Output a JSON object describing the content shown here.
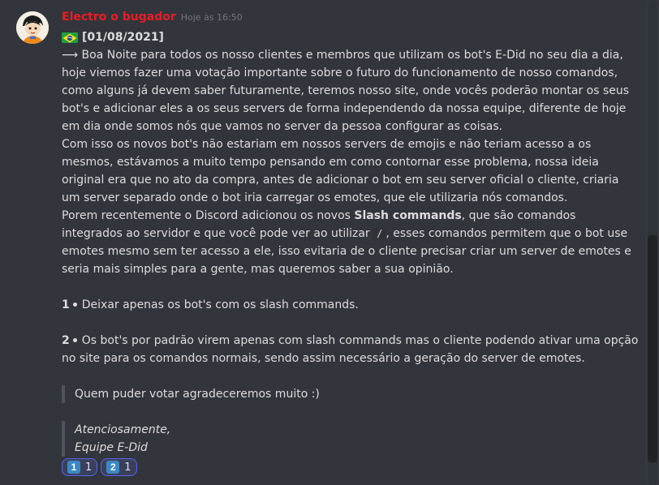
{
  "message": {
    "username": "Electro o bugador",
    "timestamp": "Hoje às 16:50",
    "date_line": "[01/08/2021]",
    "paragraph1": "⟶ Boa Noite para todos os nosso clientes e membros que utilizam os bot's E-Did no seu dia a dia, hoje viemos fazer uma votação importante sobre o futuro do funcionamento de nosso comandos, como alguns já devem saber futuramente, teremos nosso site, onde vocês poderão montar os seus bot's e adicionar eles a os seus servers de forma independendo da nossa equipe, diferente de hoje em dia onde somos nós que vamos no server da pessoa configurar as coisas.",
    "paragraph2": "Com isso os novos bot's não estariam em nossos servers de emojis e não teriam acesso a os mesmos, estávamos a muito tempo pensando em como contornar esse problema, nossa ideia original era que no ato da compra, antes de adicionar o bot em seu server oficial o cliente, criaria um server separado onde o bot iria carregar os emotes, que ele utilizaria nós comandos.",
    "paragraph3_pre": "Porem recentemente o Discord adicionou os novos ",
    "paragraph3_bold": "Slash commands",
    "paragraph3_mid": ", que são comandos integrados ao servidor e que você pode ver ao utilizar ",
    "paragraph3_code": "/",
    "paragraph3_post": ", esses comandos permitem que o bot use emotes mesmo sem ter acesso a ele, isso evitaria de o cliente precisar criar um server de emotes e seria mais simples para a gente, mas queremos saber a sua opinião.",
    "option1_num": "1",
    "option1_text": "Deixar apenas os bot's com os slash commands.",
    "option2_num": "2",
    "option2_text": "Os bot's por padrão virem apenas com slash commands mas o cliente podendo ativar uma opção no site para os comandos normais, sendo assim necessário a geração do server de emotes.",
    "quote1": "Quem puder votar agradeceremos muito :)",
    "signature_line1": "Atenciosamente,",
    "signature_line2": "Equipe E-Did"
  },
  "reactions": [
    {
      "emoji": "1",
      "count": "1"
    },
    {
      "emoji": "2",
      "count": "1"
    }
  ],
  "colors": {
    "username": "#e91d24",
    "background": "#32353b",
    "reaction_border": "#5865f2"
  }
}
